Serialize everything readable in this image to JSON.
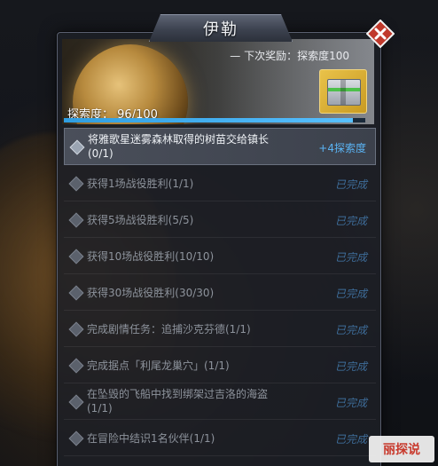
{
  "window": {
    "title": "伊勒"
  },
  "header": {
    "next_reward_label": "— 下次奖励：探索度100",
    "progress_label": "探索度：",
    "progress_value": "96/100",
    "progress_fraction": 0.96
  },
  "quests": [
    {
      "text_line1": "将雅歌星迷雾森林取得的树苗交给镇长",
      "text_line2": "(0/1)",
      "status": "+4探索度",
      "active": true
    },
    {
      "text_line1": "获得1场战役胜利(1/1)",
      "text_line2": "",
      "status": "已完成",
      "active": false
    },
    {
      "text_line1": "获得5场战役胜利(5/5)",
      "text_line2": "",
      "status": "已完成",
      "active": false
    },
    {
      "text_line1": "获得10场战役胜利(10/10)",
      "text_line2": "",
      "status": "已完成",
      "active": false
    },
    {
      "text_line1": "获得30场战役胜利(30/30)",
      "text_line2": "",
      "status": "已完成",
      "active": false
    },
    {
      "text_line1": "完成剧情任务：追捕沙克芬德(1/1)",
      "text_line2": "",
      "status": "已完成",
      "active": false
    },
    {
      "text_line1": "完成据点「利尾龙巢穴」(1/1)",
      "text_line2": "",
      "status": "已完成",
      "active": false
    },
    {
      "text_line1": "在坠毁的飞船中找到绑架过吉洛的海盗",
      "text_line2": "(1/1)",
      "status": "已完成",
      "active": false
    },
    {
      "text_line1": "在冒险中结识1名伙伴(1/1)",
      "text_line2": "",
      "status": "已完成",
      "active": false
    }
  ],
  "watermark": {
    "text": "丽探说"
  },
  "colors": {
    "accent_blue": "#57c0ff",
    "completed_blue": "#3e6d9a",
    "close_red": "#c0392b"
  },
  "icons": {
    "close": "close-icon",
    "bullet": "diamond-bullet-icon",
    "reward": "supply-crate-icon"
  }
}
